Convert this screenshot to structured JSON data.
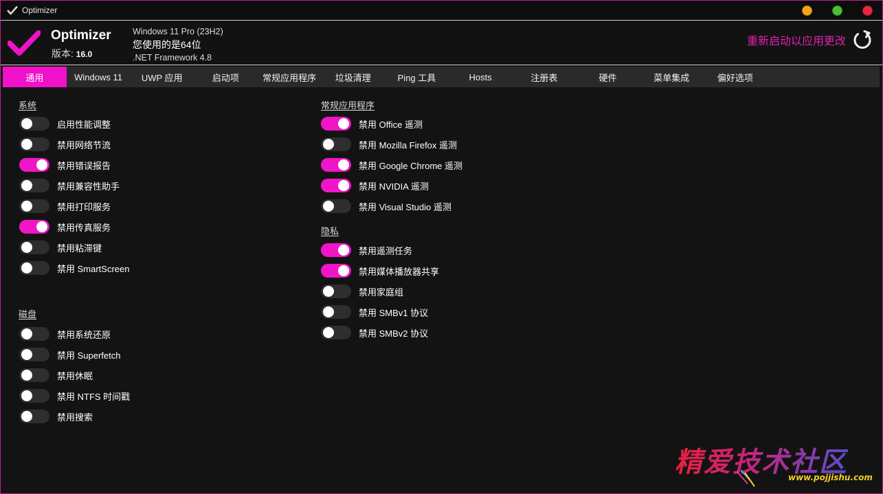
{
  "window": {
    "title": "Optimizer",
    "colors": {
      "accent": "#f012c8",
      "border": "#c0208f",
      "min": "#f6a31a",
      "max": "#4dbd39",
      "close": "#e8273d"
    }
  },
  "header": {
    "app_name": "Optimizer",
    "version_label": "版本: ",
    "version_value": "16.0",
    "os": "Windows 11 Pro (23H2)",
    "arch": "您使用的是64位",
    "framework": ".NET Framework 4.8",
    "restart_text": "重新启动以应用更改",
    "restart_icon": "refresh-icon"
  },
  "tabs": [
    {
      "label": "通用",
      "active": true
    },
    {
      "label": "Windows 11"
    },
    {
      "label": "UWP 应用"
    },
    {
      "label": "启动项"
    },
    {
      "label": "常规应用程序"
    },
    {
      "label": "垃圾清理"
    },
    {
      "label": "Ping 工具"
    },
    {
      "label": "Hosts"
    },
    {
      "label": "注册表"
    },
    {
      "label": "硬件"
    },
    {
      "label": "菜单集成"
    },
    {
      "label": "偏好选项"
    }
  ],
  "sections": {
    "system": {
      "title": "系统",
      "items": [
        {
          "label": "启用性能调整",
          "on": false
        },
        {
          "label": "禁用网络节流",
          "on": false
        },
        {
          "label": "禁用错误报告",
          "on": true
        },
        {
          "label": "禁用兼容性助手",
          "on": false
        },
        {
          "label": "禁用打印服务",
          "on": false
        },
        {
          "label": "禁用传真服务",
          "on": true
        },
        {
          "label": "禁用粘滞键",
          "on": false
        },
        {
          "label": "禁用 SmartScreen",
          "on": false
        }
      ]
    },
    "disk": {
      "title": "磁盘",
      "items": [
        {
          "label": "禁用系统还原",
          "on": false
        },
        {
          "label": "禁用 Superfetch",
          "on": false
        },
        {
          "label": "禁用休眠",
          "on": false
        },
        {
          "label": "禁用 NTFS 时间戳",
          "on": false
        },
        {
          "label": "禁用搜索",
          "on": false
        }
      ]
    },
    "apps": {
      "title": "常规应用程序",
      "items": [
        {
          "label": "禁用 Office 遥测",
          "on": true
        },
        {
          "label": "禁用 Mozilla Firefox 遥测",
          "on": false
        },
        {
          "label": "禁用 Google Chrome 遥测",
          "on": true
        },
        {
          "label": "禁用 NVIDIA 遥测",
          "on": true
        },
        {
          "label": "禁用 Visual Studio 遥测",
          "on": false
        }
      ]
    },
    "privacy": {
      "title": "隐私",
      "items": [
        {
          "label": "禁用遥测任务",
          "on": true
        },
        {
          "label": "禁用媒体播放器共享",
          "on": true
        },
        {
          "label": "禁用家庭组",
          "on": false
        },
        {
          "label": "禁用 SMBv1 协议",
          "on": false
        },
        {
          "label": "禁用 SMBv2 协议",
          "on": false
        }
      ]
    }
  },
  "watermark": {
    "title": "精爱技术社区",
    "url": "www.pojjishu.com"
  }
}
